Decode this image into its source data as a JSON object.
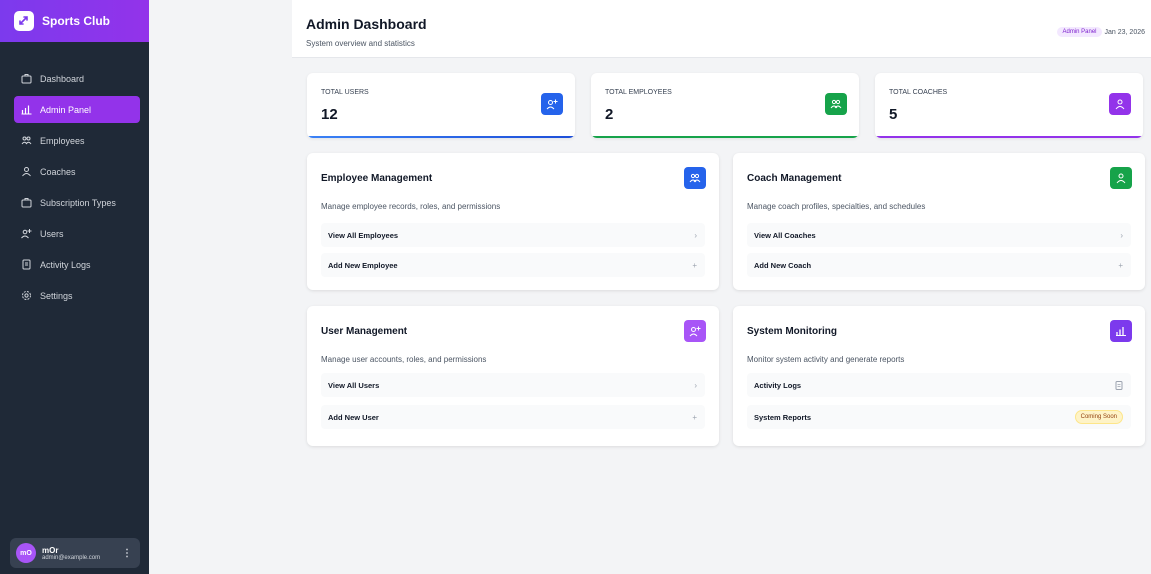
{
  "sidebar": {
    "brand": "Sports Club",
    "items": [
      {
        "label": "Dashboard",
        "icon": "briefcase-icon"
      },
      {
        "label": "Admin Panel",
        "icon": "chart-icon"
      },
      {
        "label": "Employees",
        "icon": "users-icon"
      },
      {
        "label": "Coaches",
        "icon": "user-icon"
      },
      {
        "label": "Subscription Types",
        "icon": "briefcase-icon"
      },
      {
        "label": "Users",
        "icon": "user-plus-icon"
      },
      {
        "label": "Activity Logs",
        "icon": "document-icon"
      },
      {
        "label": "Settings",
        "icon": "gear-icon"
      }
    ],
    "user": {
      "initials": "mO",
      "name": "mOr",
      "email": "admin@example.com",
      "menu": "⋮"
    }
  },
  "header": {
    "title": "Admin Dashboard",
    "subtitle": "System overview and statistics",
    "badge": "Admin Panel",
    "date": "Jan 23, 2026"
  },
  "stats": [
    {
      "label": "TOTAL USERS",
      "value": "12",
      "color": "#2563eb"
    },
    {
      "label": "TOTAL EMPLOYEES",
      "value": "2",
      "color": "#16a34a"
    },
    {
      "label": "TOTAL COACHES",
      "value": "5",
      "color": "#9333ea"
    }
  ],
  "panels": {
    "employee": {
      "title": "Employee Management",
      "desc": "Manage employee records, roles, and permissions",
      "rows": [
        "View All Employees",
        "Add New Employee"
      ]
    },
    "coach": {
      "title": "Coach Management",
      "desc": "Manage coach profiles, specialties, and schedules",
      "rows": [
        "View All Coaches",
        "Add New Coach"
      ]
    },
    "user": {
      "title": "User Management",
      "desc": "Manage user accounts, roles, and permissions",
      "rows": [
        "View All Users",
        "Add New User"
      ]
    },
    "monitoring": {
      "title": "System Monitoring",
      "desc": "Monitor system activity and generate reports",
      "rows": [
        "Activity Logs",
        "System Reports"
      ],
      "badge": "Coming Soon"
    }
  },
  "glyphs": {
    "chevron": "›",
    "plus": "+"
  },
  "colors": {
    "accent": "#9333ea",
    "sidebar_bg": "#1f2937",
    "blue": "#2563eb",
    "green": "#16a34a",
    "purple": "#9333ea"
  }
}
